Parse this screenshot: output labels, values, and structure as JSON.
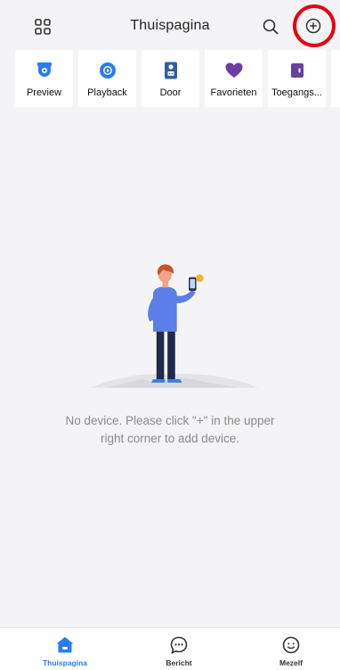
{
  "header": {
    "title": "Thuispagina",
    "left_icon": "grid-menu-icon",
    "search_icon": "search-icon",
    "add_icon": "add-circle-icon",
    "highlight_color": "#e30613"
  },
  "quick_actions": [
    {
      "label": "Preview",
      "icon": "camera-icon",
      "color": "#2b7bf3"
    },
    {
      "label": "Playback",
      "icon": "playback-icon",
      "color": "#2b7bf3"
    },
    {
      "label": "Door",
      "icon": "intercom-icon",
      "color": "#2f5fa8"
    },
    {
      "label": "Favorieten",
      "icon": "heart-icon",
      "color": "#6a3fa0"
    },
    {
      "label": "Toegangs...",
      "icon": "access-control-icon",
      "color": "#6a3fa0"
    }
  ],
  "empty_state": {
    "line1": "No device. Please click \"+\" in the upper",
    "line2": "right corner to add device."
  },
  "tabs": [
    {
      "label": "Thuispagina",
      "icon": "home-icon",
      "active": true
    },
    {
      "label": "Bericht",
      "icon": "message-icon",
      "active": false
    },
    {
      "label": "Mezelf",
      "icon": "profile-icon",
      "active": false
    }
  ],
  "colors": {
    "accent": "#2b7bf3",
    "background": "#f4f4f6",
    "text_muted": "#8b8b8b"
  }
}
